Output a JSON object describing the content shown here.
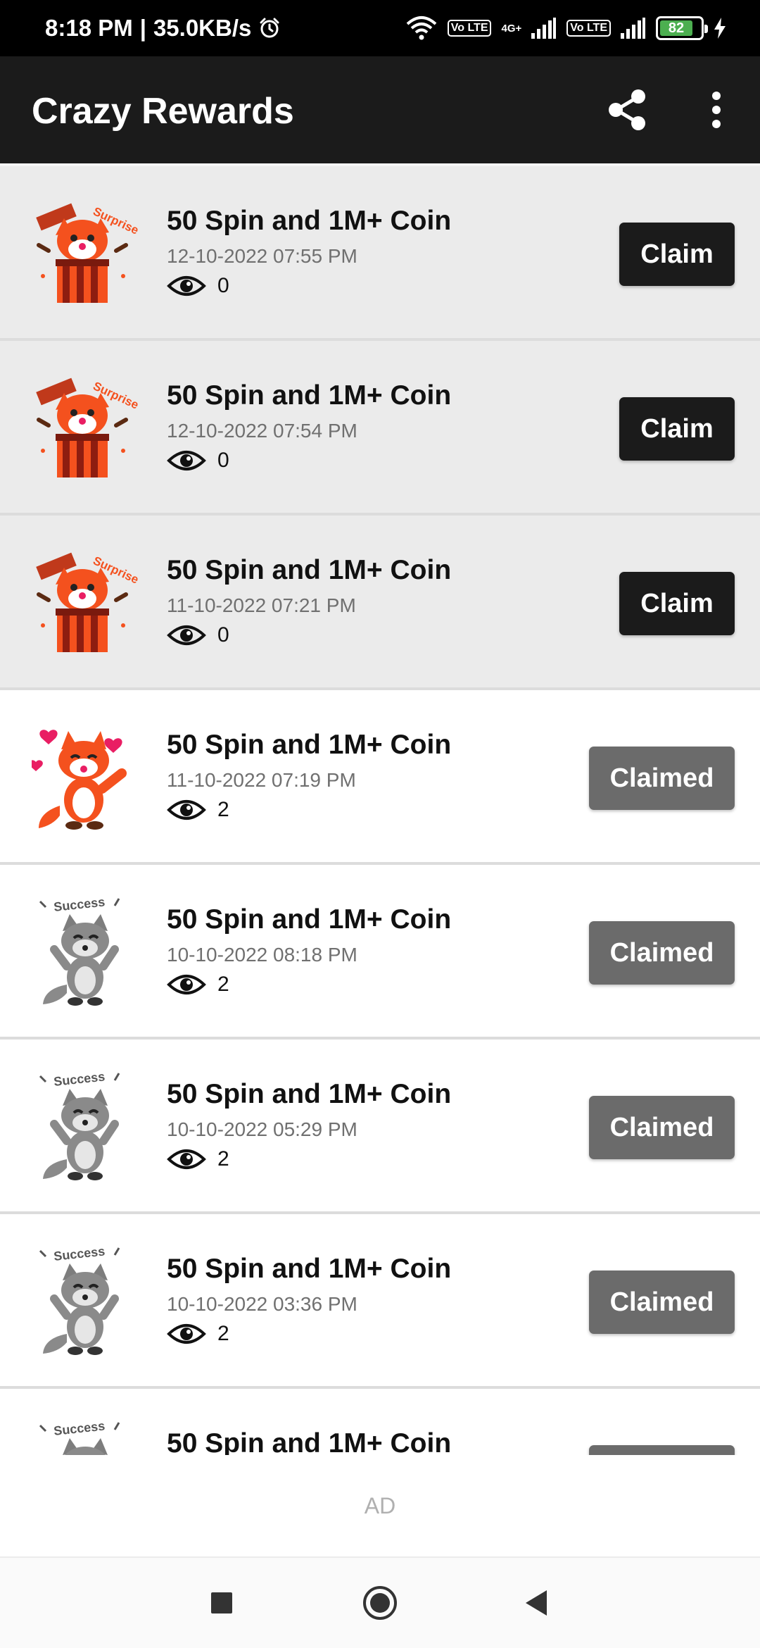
{
  "status_bar": {
    "time": "8:18 PM",
    "separator": "|",
    "net_speed": "35.0KB/s",
    "volte1": "Vo LTE",
    "net_type": "4G+",
    "volte2": "Vo LTE",
    "battery": "82"
  },
  "app_bar": {
    "title": "Crazy Rewards",
    "share_icon": "share-icon",
    "more_icon": "more-vert-icon"
  },
  "rewards": [
    {
      "title": "50 Spin and 1M+ Coin",
      "date": "12-10-2022 07:55 PM",
      "views": "0",
      "button": "Claim",
      "status": "unclaimed",
      "image": "fox-surprise-gift"
    },
    {
      "title": "50 Spin and 1M+ Coin",
      "date": "12-10-2022 07:54 PM",
      "views": "0",
      "button": "Claim",
      "status": "unclaimed",
      "image": "fox-surprise-gift"
    },
    {
      "title": "50 Spin and 1M+ Coin",
      "date": "11-10-2022 07:21 PM",
      "views": "0",
      "button": "Claim",
      "status": "unclaimed",
      "image": "fox-surprise-gift"
    },
    {
      "title": "50 Spin and 1M+ Coin",
      "date": "11-10-2022 07:19 PM",
      "views": "2",
      "button": "Claimed",
      "status": "claimed",
      "image": "fox-kiss-hearts"
    },
    {
      "title": "50 Spin and 1M+ Coin",
      "date": "10-10-2022 08:18 PM",
      "views": "2",
      "button": "Claimed",
      "status": "claimed",
      "image": "gray-fox-success"
    },
    {
      "title": "50 Spin and 1M+ Coin",
      "date": "10-10-2022 05:29 PM",
      "views": "2",
      "button": "Claimed",
      "status": "claimed",
      "image": "gray-fox-success"
    },
    {
      "title": "50 Spin and 1M+ Coin",
      "date": "10-10-2022 03:36 PM",
      "views": "2",
      "button": "Claimed",
      "status": "claimed",
      "image": "gray-fox-success"
    },
    {
      "title": "50 Spin and 1M+ Coin",
      "date": "",
      "views": "",
      "button": "",
      "status": "claimed",
      "image": "gray-fox-success"
    }
  ],
  "sticker_text": {
    "surprise": "Surprise",
    "success": "Success"
  },
  "ad": {
    "label": "AD"
  },
  "nav": {
    "recent": "square-icon",
    "home": "circle-icon",
    "back": "triangle-back-icon"
  },
  "colors": {
    "app_bar": "#1b1b1b",
    "claim_button": "#1b1b1b",
    "claimed_button": "#6b6b6b",
    "unclaimed_row": "#ebebeb",
    "fox_orange": "#f4511e"
  }
}
